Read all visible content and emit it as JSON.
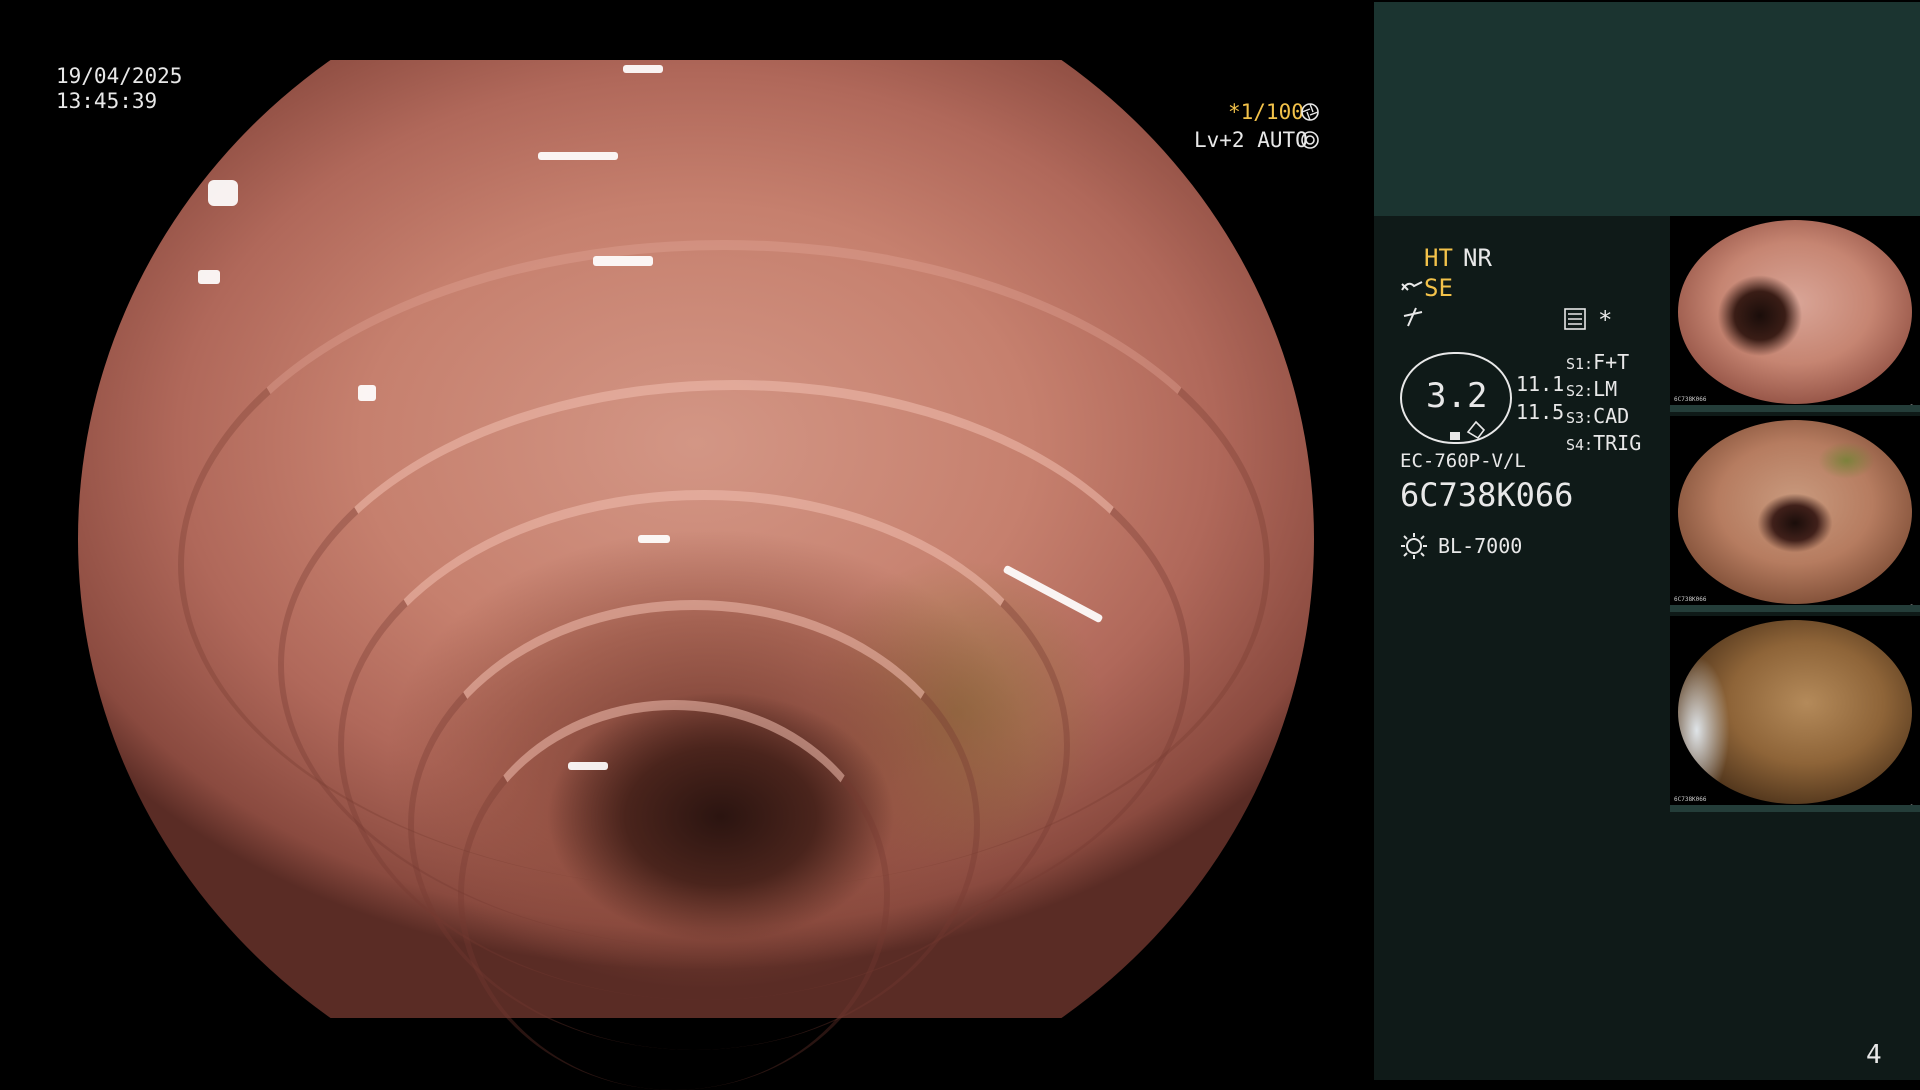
{
  "overlay": {
    "date": "19/04/2025",
    "time": "13:45:39",
    "shutter": "*1/100",
    "shutter_icon": "aperture-icon",
    "level": "Lv+2 AUTO",
    "level_icon": "iris-icon"
  },
  "panel": {
    "mode_ht": "HT",
    "mode_nr": "NR",
    "mode_se": "SE",
    "se_icon": "pen-icon",
    "zig_icon": "lightning-icon",
    "menu_icon": "settings-list-icon",
    "star": "*",
    "gauge_value": "3.2",
    "gauge_side_1": "11.1",
    "gauge_side_2": "11.5",
    "switches": [
      {
        "key": "S1:",
        "value": "F+T"
      },
      {
        "key": "S2:",
        "value": "LM"
      },
      {
        "key": "S3:",
        "value": "CAD"
      },
      {
        "key": "S4:",
        "value": "TRIG"
      }
    ],
    "scope_model": "EC-760P-V/L",
    "serial": "6C738K066",
    "light_icon": "lamp-icon",
    "light_source": "BL-7000",
    "page_number": "4"
  },
  "thumbnails": [
    {
      "label": "6C738K066",
      "index": "3"
    },
    {
      "label": "6C738K066",
      "index": "2"
    },
    {
      "label": "6C738K066",
      "index": "1"
    }
  ],
  "colors": {
    "panel_top": "#1b3430",
    "panel": "#0f1a18",
    "accent_yellow": "#f3c24a"
  }
}
